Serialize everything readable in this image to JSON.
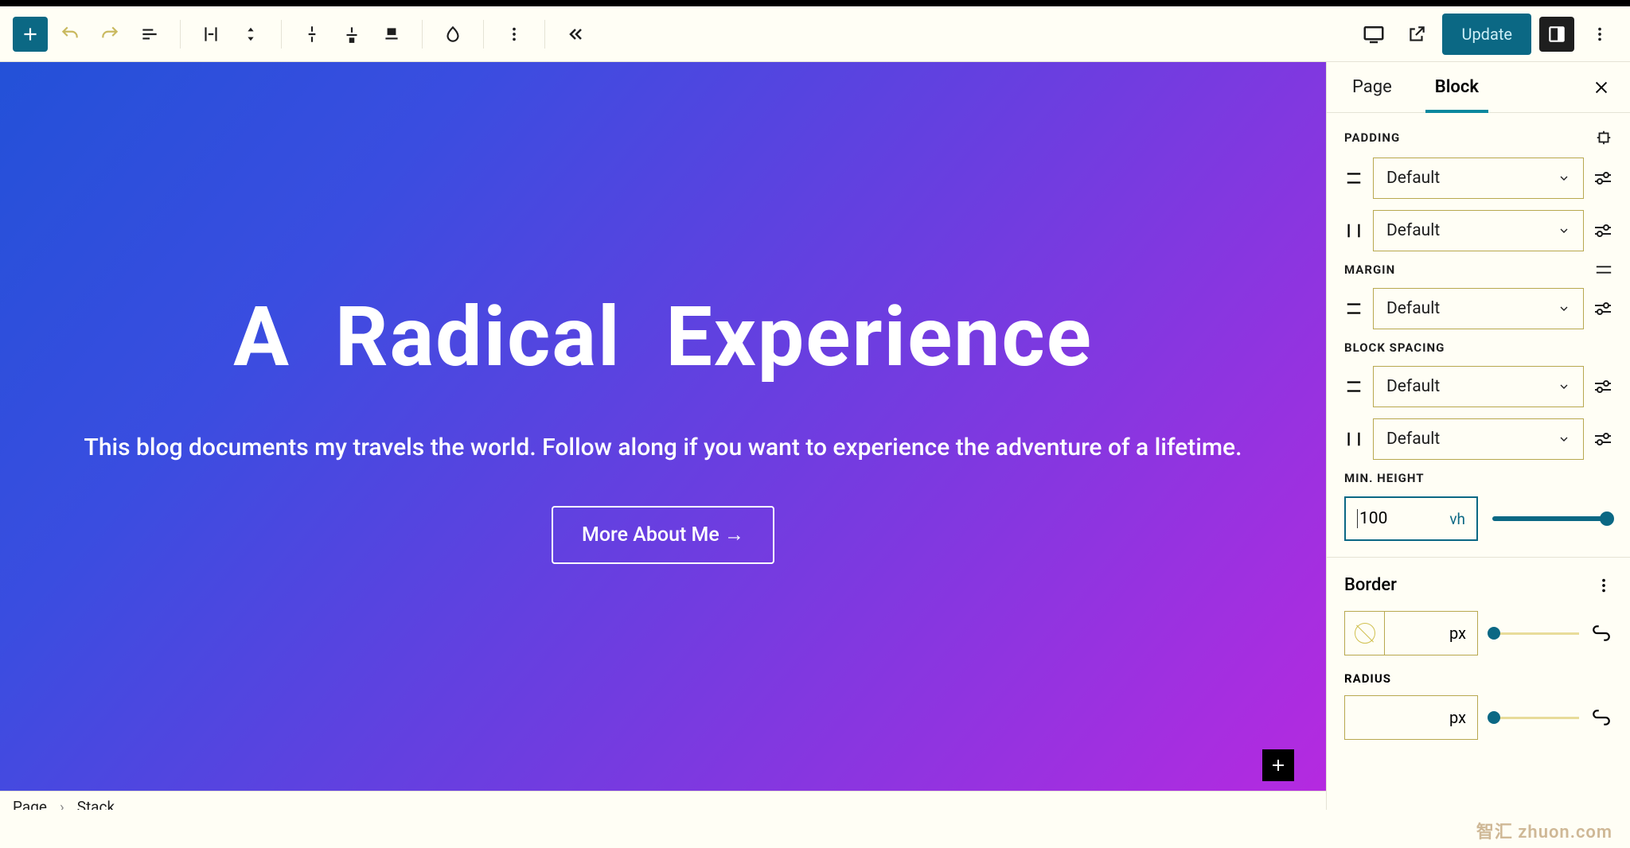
{
  "toolbar": {
    "update_label": "Update"
  },
  "hero": {
    "title": "A Radical  Experience",
    "subtitle": "This blog documents my travels the world. Follow along if you want to experience the adventure of a lifetime.",
    "button": "More About Me →"
  },
  "breadcrumb": {
    "root": "Page",
    "leaf": "Stack"
  },
  "sidebar": {
    "tabs": {
      "page": "Page",
      "block": "Block"
    },
    "padding": {
      "label": "PADDING",
      "vertical": "Default",
      "horizontal": "Default"
    },
    "margin": {
      "label": "MARGIN",
      "vertical": "Default"
    },
    "block_spacing": {
      "label": "BLOCK SPACING",
      "vertical": "Default",
      "horizontal": "Default"
    },
    "min_height": {
      "label": "MIN. HEIGHT",
      "value": "100",
      "unit": "vh"
    },
    "border": {
      "label": "Border",
      "unit": "px"
    },
    "radius": {
      "label": "RADIUS",
      "unit": "px"
    }
  },
  "watermark": "智汇 zhuon.com"
}
